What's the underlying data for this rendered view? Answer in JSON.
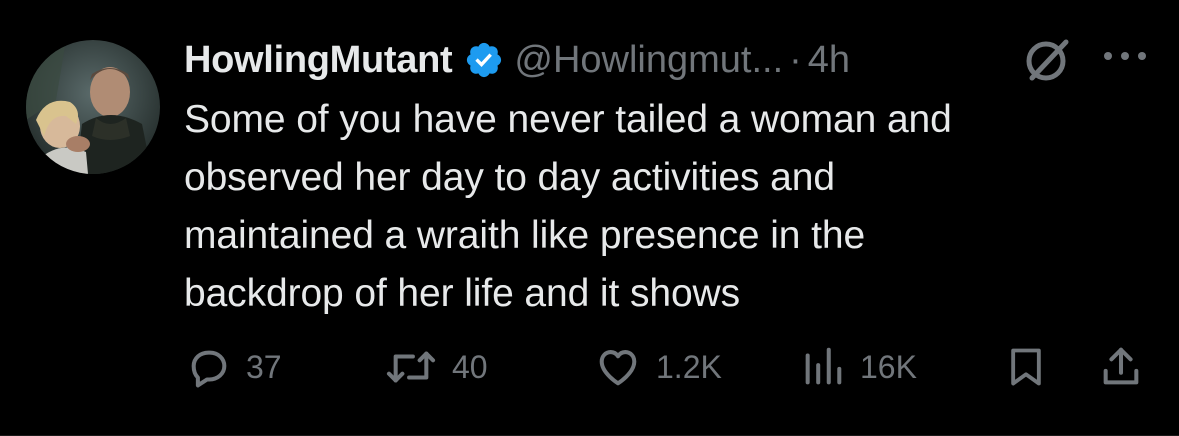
{
  "author": {
    "display_name": "HowlingMutant",
    "handle": "@Howlingmut...",
    "separator": "·",
    "time": "4h",
    "verified": true
  },
  "tweet": {
    "lines": [
      "Some of you have never tailed a woman and",
      "observed her day to day activities and",
      "maintained a wraith like presence in the",
      "backdrop of her life and it shows"
    ]
  },
  "actions": {
    "replies": "37",
    "reposts": "40",
    "likes": "1.2K",
    "views": "16K"
  },
  "icons": {
    "reply": "speech-bubble-icon",
    "repost": "repost-arrows-icon",
    "like": "heart-icon",
    "views": "bar-chart-icon",
    "bookmark": "bookmark-icon",
    "share": "share-upload-icon",
    "grok": "grok-icon",
    "more": "more-dots-icon",
    "verified": "verified-badge-icon"
  },
  "colors": {
    "background": "#000000",
    "primary_text": "#e7e9ea",
    "secondary_text": "#71767b",
    "verified_blue": "#1d9bf0"
  }
}
